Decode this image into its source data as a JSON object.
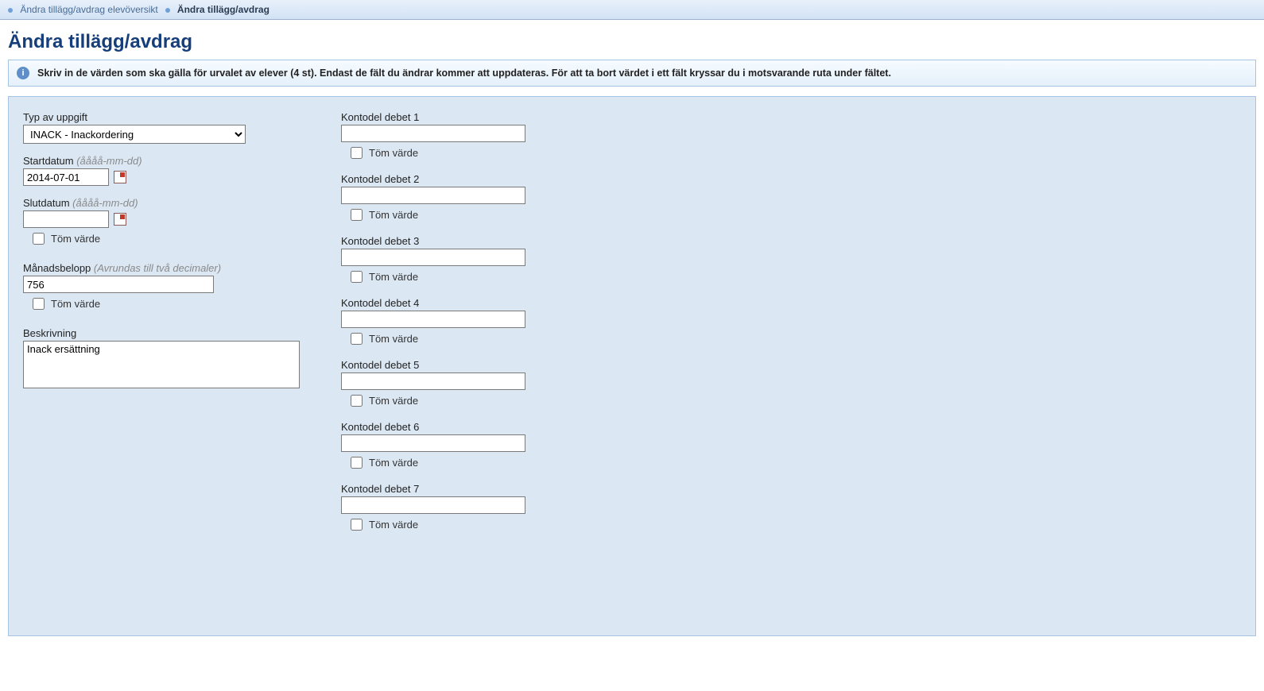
{
  "breadcrumb": {
    "link1": "Ändra tillägg/avdrag elevöversikt",
    "current": "Ändra tillägg/avdrag"
  },
  "page_title": "Ändra tillägg/avdrag",
  "info_text": "Skriv in de värden som ska gälla för urvalet av elever (4 st). Endast de fält du ändrar kommer att uppdateras. För att ta bort värdet i ett fält kryssar du i motsvarande ruta under fältet.",
  "labels": {
    "typ": "Typ av uppgift",
    "startdatum": "Startdatum",
    "slutdatum": "Slutdatum",
    "date_hint": "(åååå-mm-dd)",
    "manadsbelopp": "Månadsbelopp",
    "manadsbelopp_hint": "(Avrundas till två decimaler)",
    "beskrivning": "Beskrivning",
    "tom_varde": "Töm värde"
  },
  "values": {
    "typ_selected": "INACK - Inackordering",
    "startdatum": "2014-07-01",
    "slutdatum": "",
    "manadsbelopp": "756",
    "beskrivning": "Inack ersättning"
  },
  "kontodel": {
    "label_prefix": "Kontodel debet",
    "items": [
      {
        "n": "1",
        "value": ""
      },
      {
        "n": "2",
        "value": ""
      },
      {
        "n": "3",
        "value": ""
      },
      {
        "n": "4",
        "value": ""
      },
      {
        "n": "5",
        "value": ""
      },
      {
        "n": "6",
        "value": ""
      },
      {
        "n": "7",
        "value": ""
      }
    ]
  }
}
